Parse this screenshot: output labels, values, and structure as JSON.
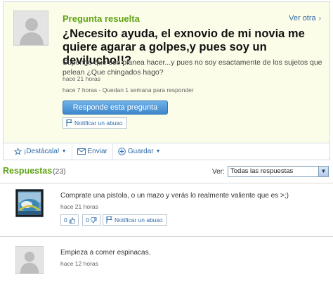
{
  "question": {
    "status": "Pregunta resuelta",
    "see_other": "Ver otra",
    "title": "¿Necesito ayuda, el exnovio de mi novia me quiere agarar a golpes,y pues soy un devilucho!!?",
    "body": "Supongo que eso planea hacer...y pues no soy esactamente de los sujetos que pelean ¿Que chingados hago?",
    "time_asked": "hace 21 horas",
    "time_remaining": "hace 7 horas - Quedan 1 semana para responder",
    "answer_button": "Responde esta pregunta",
    "report_label": "Notificar un abuso"
  },
  "toolbar": {
    "star_label": "¡Destácala!",
    "send_label": "Enviar",
    "save_label": "Guardar"
  },
  "answers_header": {
    "title": "Respuestas",
    "count": "(23)",
    "view_label": "Ver:",
    "view_selected": "Todas las respuestas"
  },
  "answers": [
    {
      "text": "Comprate una pistola, o un mazo y verás lo realmente valiente que es >;)",
      "time": "hace 21 horas",
      "thumbs_up": "0",
      "thumbs_down": "0",
      "report_label": "Notificar un abuso"
    },
    {
      "text": "Empieza a comer espinacas.",
      "time": "hace 12 horas"
    }
  ],
  "colors": {
    "accent_green": "#5ea415",
    "link_blue": "#2d6aa8",
    "card_bg": "#fcfde9"
  }
}
